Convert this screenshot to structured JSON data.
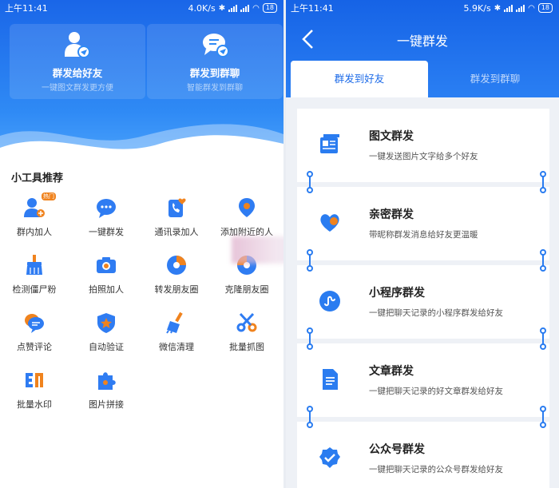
{
  "left": {
    "status": {
      "time": "上午11:41",
      "speed": "4.0K/s",
      "battery": "18"
    },
    "header_cards": [
      {
        "title": "群发给好友",
        "subtitle": "一键图文群发更方便",
        "icon": "user-send-icon"
      },
      {
        "title": "群发到群聊",
        "subtitle": "智能群发到群聊",
        "icon": "group-chat-send-icon"
      }
    ],
    "section_title": "小工具推荐",
    "hot_badge": "热门",
    "tools": [
      {
        "label": "群内加人",
        "icon": "user-plus-icon"
      },
      {
        "label": "一键群发",
        "icon": "chat-bubble-icon"
      },
      {
        "label": "通讯录加人",
        "icon": "phone-book-icon"
      },
      {
        "label": "添加附近的人",
        "icon": "location-pin-icon"
      },
      {
        "label": "检测僵尸粉",
        "icon": "broom-icon"
      },
      {
        "label": "拍照加人",
        "icon": "camera-icon"
      },
      {
        "label": "转发朋友圈",
        "icon": "shutter-icon"
      },
      {
        "label": "克隆朋友圈",
        "icon": "clone-shutter-icon"
      },
      {
        "label": "点赞评论",
        "icon": "comment-cloud-icon"
      },
      {
        "label": "自动验证",
        "icon": "shield-star-icon"
      },
      {
        "label": "微信清理",
        "icon": "brush-clean-icon"
      },
      {
        "label": "批量抓图",
        "icon": "scissors-icon"
      },
      {
        "label": "批量水印",
        "icon": "watermark-icon"
      },
      {
        "label": "图片拼接",
        "icon": "puzzle-icon"
      }
    ]
  },
  "right": {
    "status": {
      "time": "上午11:41",
      "speed": "5.9K/s",
      "battery": "18"
    },
    "title": "一键群发",
    "tabs": [
      {
        "label": "群发到好友",
        "active": true
      },
      {
        "label": "群发到群聊",
        "active": false
      }
    ],
    "cards": [
      {
        "title": "图文群发",
        "subtitle": "一键发送图片文字给多个好友",
        "icon": "image-text-icon"
      },
      {
        "title": "亲密群发",
        "subtitle": "带昵称群发消息给好友更温暖",
        "icon": "heart-chat-icon"
      },
      {
        "title": "小程序群发",
        "subtitle": "一键把聊天记录的小程序群发给好友",
        "icon": "mini-program-icon"
      },
      {
        "title": "文章群发",
        "subtitle": "一键把聊天记录的好文章群发给好友",
        "icon": "article-icon"
      },
      {
        "title": "公众号群发",
        "subtitle": "一键把聊天记录的公众号群发给好友",
        "icon": "verified-badge-icon"
      }
    ]
  },
  "colors": {
    "primary": "#1d6be8",
    "accent_orange": "#f0831e",
    "text_dark": "#222222"
  }
}
